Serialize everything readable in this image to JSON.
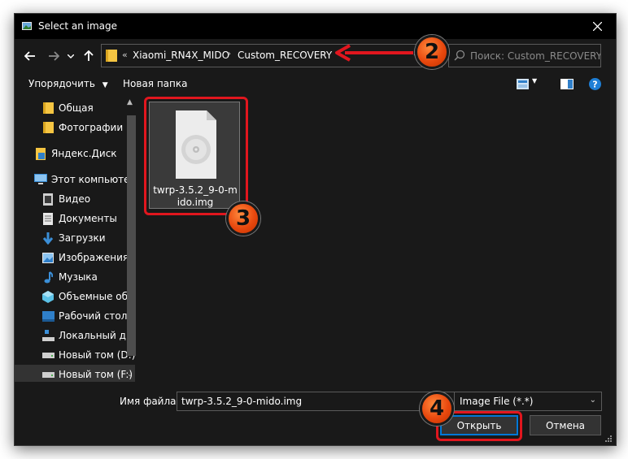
{
  "window": {
    "title": "Select an image"
  },
  "address": {
    "overflow_chevrons": "«",
    "crumbs": [
      "Xiaomi_RN4X_MIDO",
      "Custom_RECOVERY"
    ]
  },
  "search": {
    "placeholder": "Поиск: Custom_RECOVERY"
  },
  "toolbar": {
    "organize_label": "Упорядочить",
    "new_folder_label": "Новая папка"
  },
  "sidebar": {
    "items": [
      {
        "label": "Общая",
        "icon": "folder-icon"
      },
      {
        "label": "Фотографии",
        "icon": "folder-icon"
      },
      {
        "label": "Яндекс.Диск",
        "icon": "yandex-disk-icon"
      },
      {
        "label": "Этот компьютер",
        "icon": "computer-icon"
      },
      {
        "label": "Видео",
        "icon": "video-icon"
      },
      {
        "label": "Документы",
        "icon": "documents-icon"
      },
      {
        "label": "Загрузки",
        "icon": "download-icon"
      },
      {
        "label": "Изображения",
        "icon": "pictures-icon"
      },
      {
        "label": "Музыка",
        "icon": "music-icon"
      },
      {
        "label": "Объемные объ",
        "icon": "3d-objects-icon"
      },
      {
        "label": "Рабочий стол",
        "icon": "desktop-icon"
      },
      {
        "label": "Локальный дис",
        "icon": "local-disk-icon"
      },
      {
        "label": "Новый том (D:)",
        "icon": "drive-icon"
      },
      {
        "label": "Новый том (F:)",
        "icon": "drive-icon"
      }
    ]
  },
  "files": [
    {
      "name": "twrp-3.5.2_9-0-mido.img",
      "icon": "disc-image-file-icon"
    }
  ],
  "bottom": {
    "filename_label": "Имя файла:",
    "filename_value": "twrp-3.5.2_9-0-mido.img",
    "filter_value": "Image File (*.*)",
    "open_label": "Открыть",
    "cancel_label": "Отмена"
  },
  "annotations": {
    "badge_2": "2",
    "badge_3": "3",
    "badge_4": "4"
  },
  "colors": {
    "background": "#191919",
    "highlight": "#e1161e",
    "badge": "#e8480e",
    "accent": "#0078d7"
  }
}
